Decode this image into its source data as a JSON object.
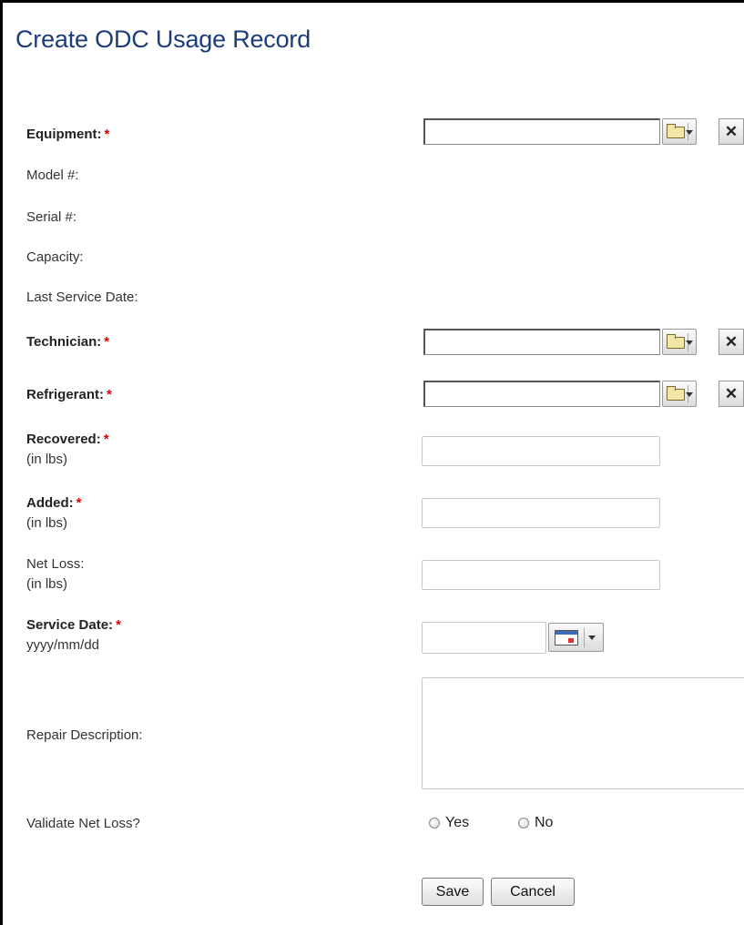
{
  "page": {
    "title": "Create ODC Usage Record"
  },
  "fields": {
    "equipment": {
      "label": "Equipment:",
      "required": "*",
      "value": ""
    },
    "model": {
      "label": "Model #:"
    },
    "serial": {
      "label": "Serial #:"
    },
    "capacity": {
      "label": "Capacity:"
    },
    "last_service": {
      "label": "Last Service Date:"
    },
    "technician": {
      "label": "Technician:",
      "required": "*",
      "value": ""
    },
    "refrigerant": {
      "label": "Refrigerant:",
      "required": "*",
      "value": ""
    },
    "recovered": {
      "label": "Recovered:",
      "required": "*",
      "unit": "(in lbs)",
      "value": ""
    },
    "added": {
      "label": "Added:",
      "required": "*",
      "unit": "(in lbs)",
      "value": ""
    },
    "net_loss": {
      "label": "Net Loss:",
      "unit": "(in lbs)",
      "value": ""
    },
    "service_date": {
      "label": "Service Date:",
      "required": "*",
      "format": "yyyy/mm/dd",
      "value": ""
    },
    "repair_description": {
      "label": "Repair Description:",
      "value": ""
    },
    "validate_net_loss": {
      "label": "Validate Net Loss?",
      "options": [
        "Yes",
        "No"
      ],
      "selected": ""
    }
  },
  "actions": {
    "save": "Save",
    "cancel": "Cancel"
  },
  "icons": {
    "lookup": "folder-icon",
    "dropdown": "chevron-down-icon",
    "clear": "close-icon",
    "calendar": "calendar-icon"
  },
  "colors": {
    "title": "#1c3d7a",
    "required": "#dd0000"
  }
}
